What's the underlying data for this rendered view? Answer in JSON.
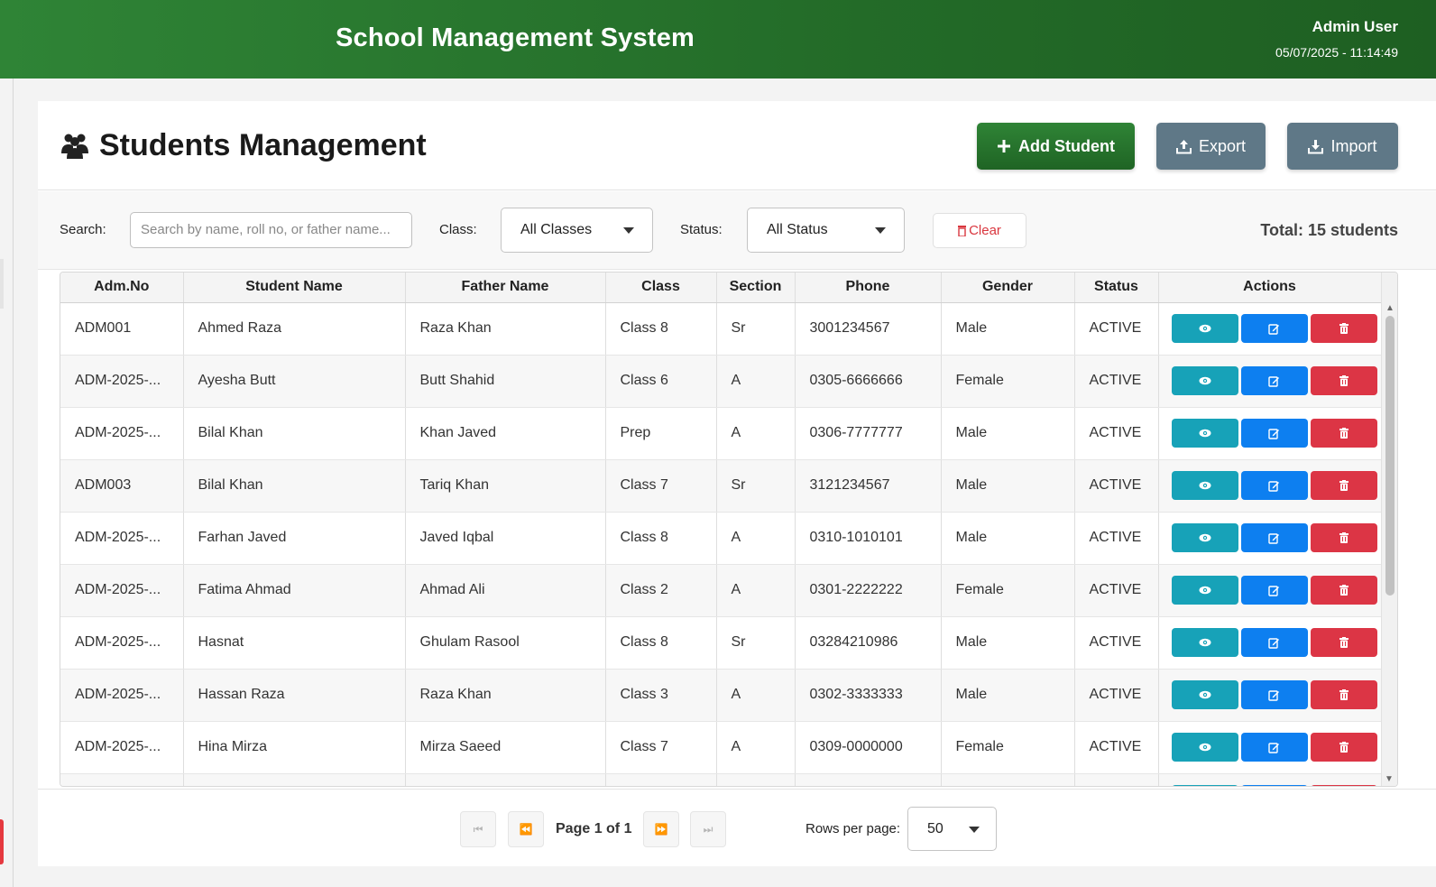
{
  "header": {
    "app_title": "School Management System",
    "user_name": "Admin User",
    "datetime": "05/07/2025 - 11:14:49"
  },
  "page": {
    "title": "Students Management",
    "icon": "users-icon",
    "buttons": {
      "add": "Add Student",
      "export": "Export",
      "import": "Import"
    }
  },
  "filters": {
    "search_label": "Search:",
    "search_placeholder": "Search by name, roll no, or father name...",
    "class_label": "Class:",
    "class_value": "All Classes",
    "status_label": "Status:",
    "status_value": "All Status",
    "clear_label": "Clear",
    "total_text": "Total: 15 students"
  },
  "table": {
    "columns": [
      "Adm.No",
      "Student Name",
      "Father Name",
      "Class",
      "Section",
      "Phone",
      "Gender",
      "Status",
      "Actions"
    ],
    "rows": [
      [
        "ADM001",
        "Ahmed Raza",
        "Raza Khan",
        "Class 8",
        "Sr",
        "3001234567",
        "Male",
        "ACTIVE"
      ],
      [
        "ADM-2025-...",
        "Ayesha Butt",
        "Butt Shahid",
        "Class 6",
        "A",
        "0305-6666666",
        "Female",
        "ACTIVE"
      ],
      [
        "ADM-2025-...",
        "Bilal Khan",
        "Khan Javed",
        "Prep",
        "A",
        "0306-7777777",
        "Male",
        "ACTIVE"
      ],
      [
        "ADM003",
        "Bilal Khan",
        "Tariq Khan",
        "Class 7",
        "Sr",
        "3121234567",
        "Male",
        "ACTIVE"
      ],
      [
        "ADM-2025-...",
        "Farhan Javed",
        "Javed Iqbal",
        "Class 8",
        "A",
        "0310-1010101",
        "Male",
        "ACTIVE"
      ],
      [
        "ADM-2025-...",
        "Fatima Ahmad",
        "Ahmad Ali",
        "Class 2",
        "A",
        "0301-2222222",
        "Female",
        "ACTIVE"
      ],
      [
        "ADM-2025-...",
        "Hasnat",
        "Ghulam Rasool",
        "Class 8",
        "Sr",
        "03284210986",
        "Male",
        "ACTIVE"
      ],
      [
        "ADM-2025-...",
        "Hassan Raza",
        "Raza Khan",
        "Class 3",
        "A",
        "0302-3333333",
        "Male",
        "ACTIVE"
      ],
      [
        "ADM-2025-...",
        "Hina Mirza",
        "Mirza Saeed",
        "Class 7",
        "A",
        "0309-0000000",
        "Female",
        "ACTIVE"
      ],
      [
        "",
        "",
        "",
        "",
        "",
        "",
        "",
        ""
      ]
    ],
    "action_icons": [
      "eye-icon",
      "edit-icon",
      "trash-icon"
    ]
  },
  "pagination": {
    "page_info": "Page 1 of 1",
    "rows_per_page_label": "Rows per page:",
    "rows_per_page_value": "50"
  },
  "colors": {
    "header_green": "#236b28",
    "add_button": "#1f6424",
    "secondary_button": "#5f7887",
    "view_button": "#17a2b8",
    "edit_button": "#0d7ff0",
    "delete_button": "#dc3545"
  }
}
